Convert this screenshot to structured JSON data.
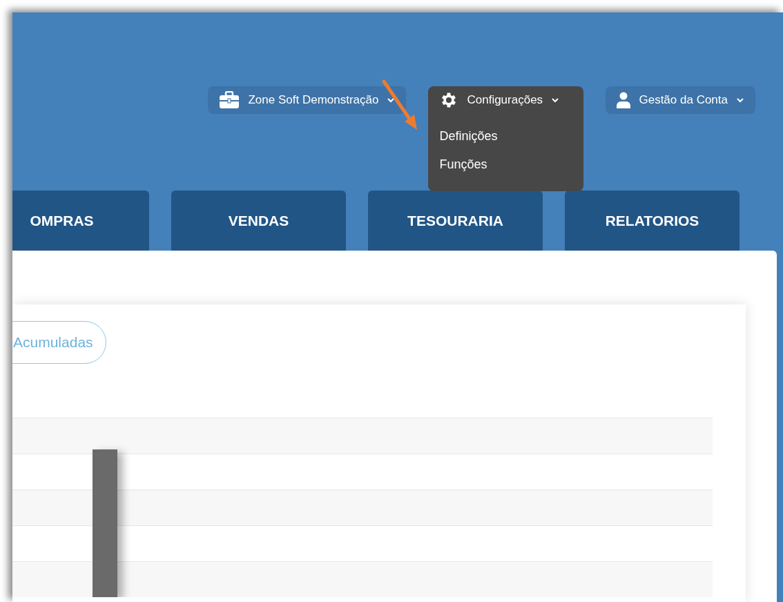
{
  "top_nav": [
    {
      "label": "Zone Soft Demonstração",
      "open": false
    },
    {
      "label": "Configurações",
      "open": true,
      "items": [
        "Definições",
        "Funções"
      ]
    },
    {
      "label": "Gestão da Conta",
      "open": false
    }
  ],
  "tabs": [
    "OMPRAS",
    "VENDAS",
    "TESOURARIA",
    "RELATORIOS"
  ],
  "filter_button": "Acumuladas"
}
